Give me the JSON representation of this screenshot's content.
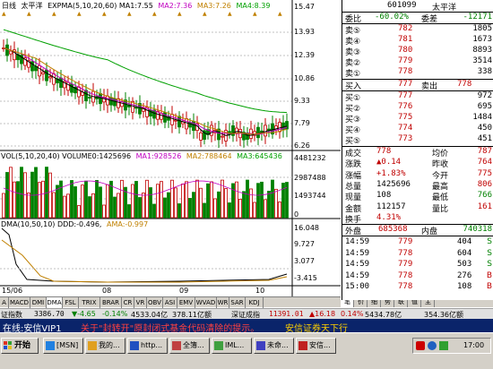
{
  "chart": {
    "period_label": "日线",
    "stock_name": "太平洋",
    "ma_title": "EXPMA(5,10,20,60) MA1:7.55",
    "ma2": "MA2:7.36",
    "ma3": "MA3:7.26",
    "ma4": "MA4:8.39",
    "price_ticks": [
      "15.47",
      "13.93",
      "12.39",
      "10.86",
      "9.33",
      "7.79",
      "6.26"
    ],
    "vol_title": "VOL(5,10,20,40) VOLUME0:1425696",
    "vol_ma1": "MA1:928526",
    "vol_ma2": "MA2:788464",
    "vol_ma3": "MA3:645436",
    "vol_ticks": [
      "4481232",
      "2987488",
      "1493744",
      "0"
    ],
    "dma_title": "DMA(10,50,10) DDD:-0.496,",
    "ama_title": "AMA:-0.997",
    "dma_ticks": [
      "16.048",
      "9.727",
      "3.077",
      "-3.415"
    ],
    "x_labels": [
      "15/06",
      "08",
      "09",
      "10"
    ],
    "colors": {
      "up": "#c00000",
      "down": "#008000",
      "ma1": "#000000",
      "ma2": "#c000c0",
      "ma3": "#c08000",
      "ma4": "#00a000"
    }
  },
  "tabs": [
    "A",
    "MACD",
    "DMI",
    "DMA",
    "FSL",
    "TRIX",
    "BRAR",
    "CR",
    "VR",
    "OBV",
    "ASI",
    "EMV",
    "WVAD",
    "WR",
    "SAR",
    "KDJ"
  ],
  "right_tabs": [
    "笔",
    "价",
    "细",
    "势",
    "联",
    "值",
    "主"
  ],
  "quote": {
    "code": "601099",
    "name": "太平洋",
    "weibi_label": "委比",
    "weibi": "-60.02%",
    "weicha_label": "委差",
    "weicha": "-12171",
    "asks": [
      {
        "label": "卖⑤",
        "price": "782",
        "vol": "1805"
      },
      {
        "label": "卖④",
        "price": "781",
        "vol": "1673"
      },
      {
        "label": "卖③",
        "price": "780",
        "vol": "8893"
      },
      {
        "label": "卖②",
        "price": "779",
        "vol": "3514"
      },
      {
        "label": "卖①",
        "price": "778",
        "vol": "338"
      }
    ],
    "buy1_label": "买入",
    "buy1_price": "777",
    "sell_label": "卖出",
    "sell_price": "778",
    "bids": [
      {
        "label": "买①",
        "price": "777",
        "vol": "972"
      },
      {
        "label": "买②",
        "price": "776",
        "vol": "695"
      },
      {
        "label": "买③",
        "price": "775",
        "vol": "1484"
      },
      {
        "label": "买④",
        "price": "774",
        "vol": "450"
      },
      {
        "label": "买⑤",
        "price": "773",
        "vol": "451"
      }
    ],
    "stats": [
      {
        "l1": "成交",
        "v1": "778",
        "l2": "均价",
        "v2": "787"
      },
      {
        "l1": "涨跌",
        "v1": "▲0.14",
        "l2": "昨收",
        "v2": "764"
      },
      {
        "l1": "涨幅",
        "v1": "+1.83%",
        "l2": "今开",
        "v2": "775"
      },
      {
        "l1": "总量",
        "v1": "1425696",
        "l2": "最高",
        "v2": "806"
      },
      {
        "l1": "现量",
        "v1": "108",
        "l2": "最低",
        "v2": "766"
      },
      {
        "l1": "金额",
        "v1": "112157",
        "l2": "量比",
        "v2": "161"
      },
      {
        "l1": "换手",
        "v1": "4.31%",
        "l2": "",
        "v2": ""
      }
    ],
    "outer_label": "外盘",
    "outer_val": "685368",
    "inner_label": "内盘",
    "inner_val": "740318",
    "ticks": [
      {
        "time": "14:59",
        "price": "779",
        "vol": "404",
        "dir": "S"
      },
      {
        "time": "14:59",
        "price": "778",
        "vol": "604",
        "dir": "S"
      },
      {
        "time": "14:59",
        "price": "779",
        "vol": "503",
        "dir": "S"
      },
      {
        "time": "14:59",
        "price": "778",
        "vol": "276",
        "dir": "B"
      },
      {
        "time": "15:00",
        "price": "778",
        "vol": "108",
        "dir": "B"
      }
    ]
  },
  "indexbar": {
    "sh_label": "证指数",
    "sh_val": "3386.70",
    "sh_chg": "▼-4.65",
    "sh_pct": "-0.14%",
    "sh_amt": "4533.04亿",
    "sh_x": "378.11亿额",
    "sz_label": "深证成指",
    "sz_val": "11391.01",
    "sz_chg": "▲16.18",
    "sz_pct": "0.14%",
    "sz_amt": "5434.78亿",
    "sz_x": "354.36亿额"
  },
  "status": {
    "left": "在线:安信VIP1",
    "news": "关于\"封转开\"原封闭式基金代码清除的提示。",
    "right": "安信证券天下行"
  },
  "taskbar": {
    "start": "开始",
    "buttons": [
      "[MSN]",
      "我的...",
      "http...",
      "全簿...",
      "IML...",
      "未命...",
      "安信..."
    ],
    "clock": "17:00"
  }
}
